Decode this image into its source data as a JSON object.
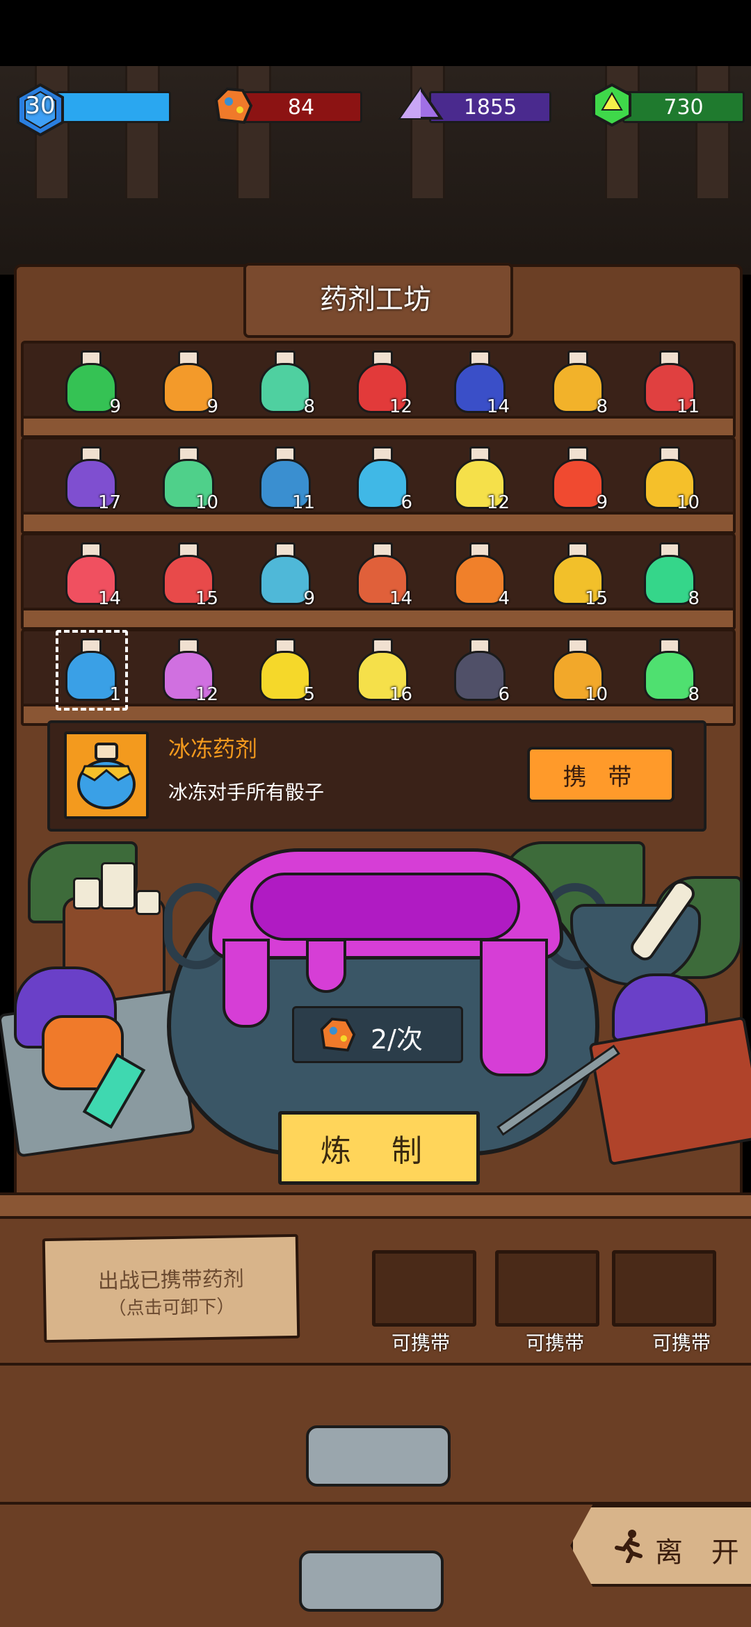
{
  "hud": {
    "level": "30",
    "ore": "84",
    "crystal": "1855",
    "gem": "730"
  },
  "workshop": {
    "title": "药剂工坊"
  },
  "shelves": [
    [
      {
        "count": "9",
        "color": "#35c254"
      },
      {
        "count": "9",
        "color": "#f39a2a"
      },
      {
        "count": "8",
        "color": "#4fd0a0"
      },
      {
        "count": "12",
        "color": "#e23a3a"
      },
      {
        "count": "14",
        "color": "#3a4fc8"
      },
      {
        "count": "8",
        "color": "#f2b22a"
      },
      {
        "count": "11",
        "color": "#e04040"
      }
    ],
    [
      {
        "count": "17",
        "color": "#7f4fd0"
      },
      {
        "count": "10",
        "color": "#4fd08a"
      },
      {
        "count": "11",
        "color": "#3a8fd0"
      },
      {
        "count": "6",
        "color": "#40b8e6"
      },
      {
        "count": "12",
        "color": "#f5e04a"
      },
      {
        "count": "9",
        "color": "#f04a30"
      },
      {
        "count": "10",
        "color": "#f5c02a"
      }
    ],
    [
      {
        "count": "14",
        "color": "#f05060"
      },
      {
        "count": "15",
        "color": "#e84a4a"
      },
      {
        "count": "9",
        "color": "#4fb8d8"
      },
      {
        "count": "14",
        "color": "#e0603a"
      },
      {
        "count": "4",
        "color": "#f0802a"
      },
      {
        "count": "15",
        "color": "#f2c02a"
      },
      {
        "count": "8",
        "color": "#35d68a"
      }
    ],
    [
      {
        "count": "1",
        "color": "#3aa0e6"
      },
      {
        "count": "12",
        "color": "#d070e0"
      },
      {
        "count": "5",
        "color": "#f5d82a"
      },
      {
        "count": "16",
        "color": "#f5e04a"
      },
      {
        "count": "6",
        "color": "#505068"
      },
      {
        "count": "10",
        "color": "#f2a82a"
      },
      {
        "count": "8",
        "color": "#4fe070"
      }
    ]
  ],
  "selected_potion": {
    "name": "冰冻药剂",
    "description": "冰冻对手所有骰子",
    "carry_label": "携 带"
  },
  "cauldron": {
    "cost": "2/次",
    "brew_label": "炼 制"
  },
  "loadout": {
    "sign_line1": "出战已携带药剂",
    "sign_line2": "（点击可卸下）",
    "slots": [
      "可携带",
      "可携带",
      "可携带"
    ]
  },
  "leave_label": "离 开",
  "colors": {
    "health_bar": "#2aa7f0",
    "ore_bar": "#8c1313",
    "crystal_bar": "#4a2a8e",
    "gem_bar": "#1f7a2e",
    "accent_orange": "#ff9a2a",
    "title_orange": "#f39a1e"
  }
}
